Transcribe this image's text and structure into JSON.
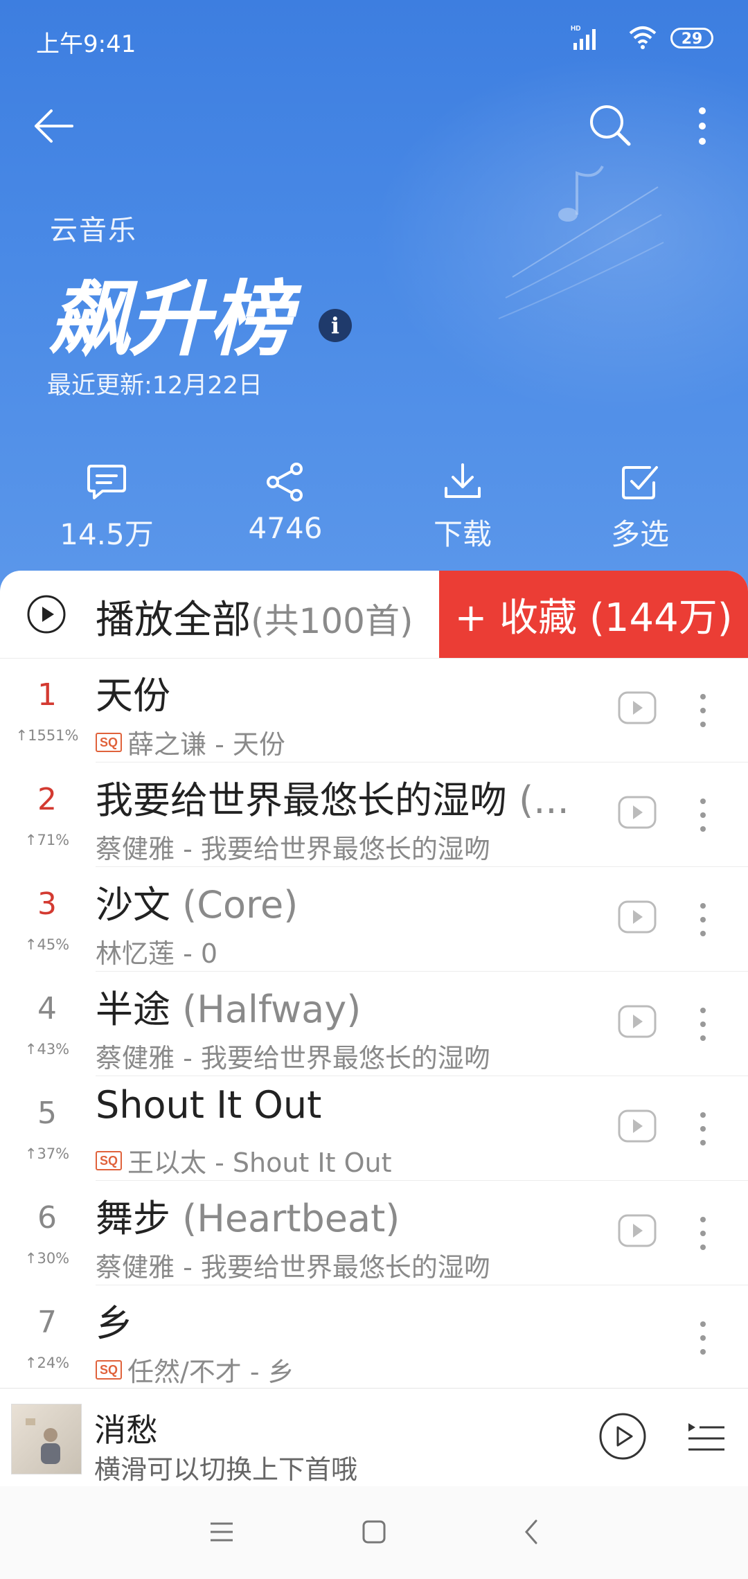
{
  "status": {
    "time": "上午9:41",
    "battery": "29",
    "network": "HD"
  },
  "header": {
    "brand": "云音乐",
    "title": "飙升榜",
    "updated": "最近更新:12月22日"
  },
  "actions": [
    {
      "icon": "comment-icon",
      "label": "14.5万"
    },
    {
      "icon": "share-icon",
      "label": "4746"
    },
    {
      "icon": "download-icon",
      "label": "下载"
    },
    {
      "icon": "multiselect-icon",
      "label": "多选"
    }
  ],
  "playall": {
    "label": "播放全部",
    "count": "(共100首)",
    "favorite": "+ 收藏 (144万)"
  },
  "songs": [
    {
      "rank": "1",
      "change": "↑1551%",
      "title": "天份",
      "alias": "",
      "sq": true,
      "artist": "薛之谦 - 天份",
      "mv": true
    },
    {
      "rank": "2",
      "change": "↑71%",
      "title": "我要给世界最悠长的湿吻",
      "alias": " (...",
      "sq": false,
      "artist": "蔡健雅 - 我要给世界最悠长的湿吻",
      "mv": true
    },
    {
      "rank": "3",
      "change": "↑45%",
      "title": "沙文",
      "alias": " (Core)",
      "sq": false,
      "artist": "林忆莲 - 0",
      "mv": true
    },
    {
      "rank": "4",
      "change": "↑43%",
      "title": "半途",
      "alias": " (Halfway)",
      "sq": false,
      "artist": "蔡健雅 - 我要给世界最悠长的湿吻",
      "mv": true
    },
    {
      "rank": "5",
      "change": "↑37%",
      "title": "Shout It Out",
      "alias": "",
      "sq": true,
      "artist": "王以太 - Shout It Out",
      "mv": true
    },
    {
      "rank": "6",
      "change": "↑30%",
      "title": "舞步",
      "alias": " (Heartbeat)",
      "sq": false,
      "artist": "蔡健雅 - 我要给世界最悠长的湿吻",
      "mv": true
    },
    {
      "rank": "7",
      "change": "↑24%",
      "title": "乡",
      "alias": "",
      "sq": true,
      "artist": "任然/不才 - 乡",
      "mv": false
    }
  ],
  "sq_label": "SQ",
  "miniplayer": {
    "song": "消愁",
    "hint": "横滑可以切换上下首哦"
  },
  "colors": {
    "accent": "#eb3d35",
    "hero": "#4a8ae6",
    "rank_hot": "#d33a31"
  }
}
